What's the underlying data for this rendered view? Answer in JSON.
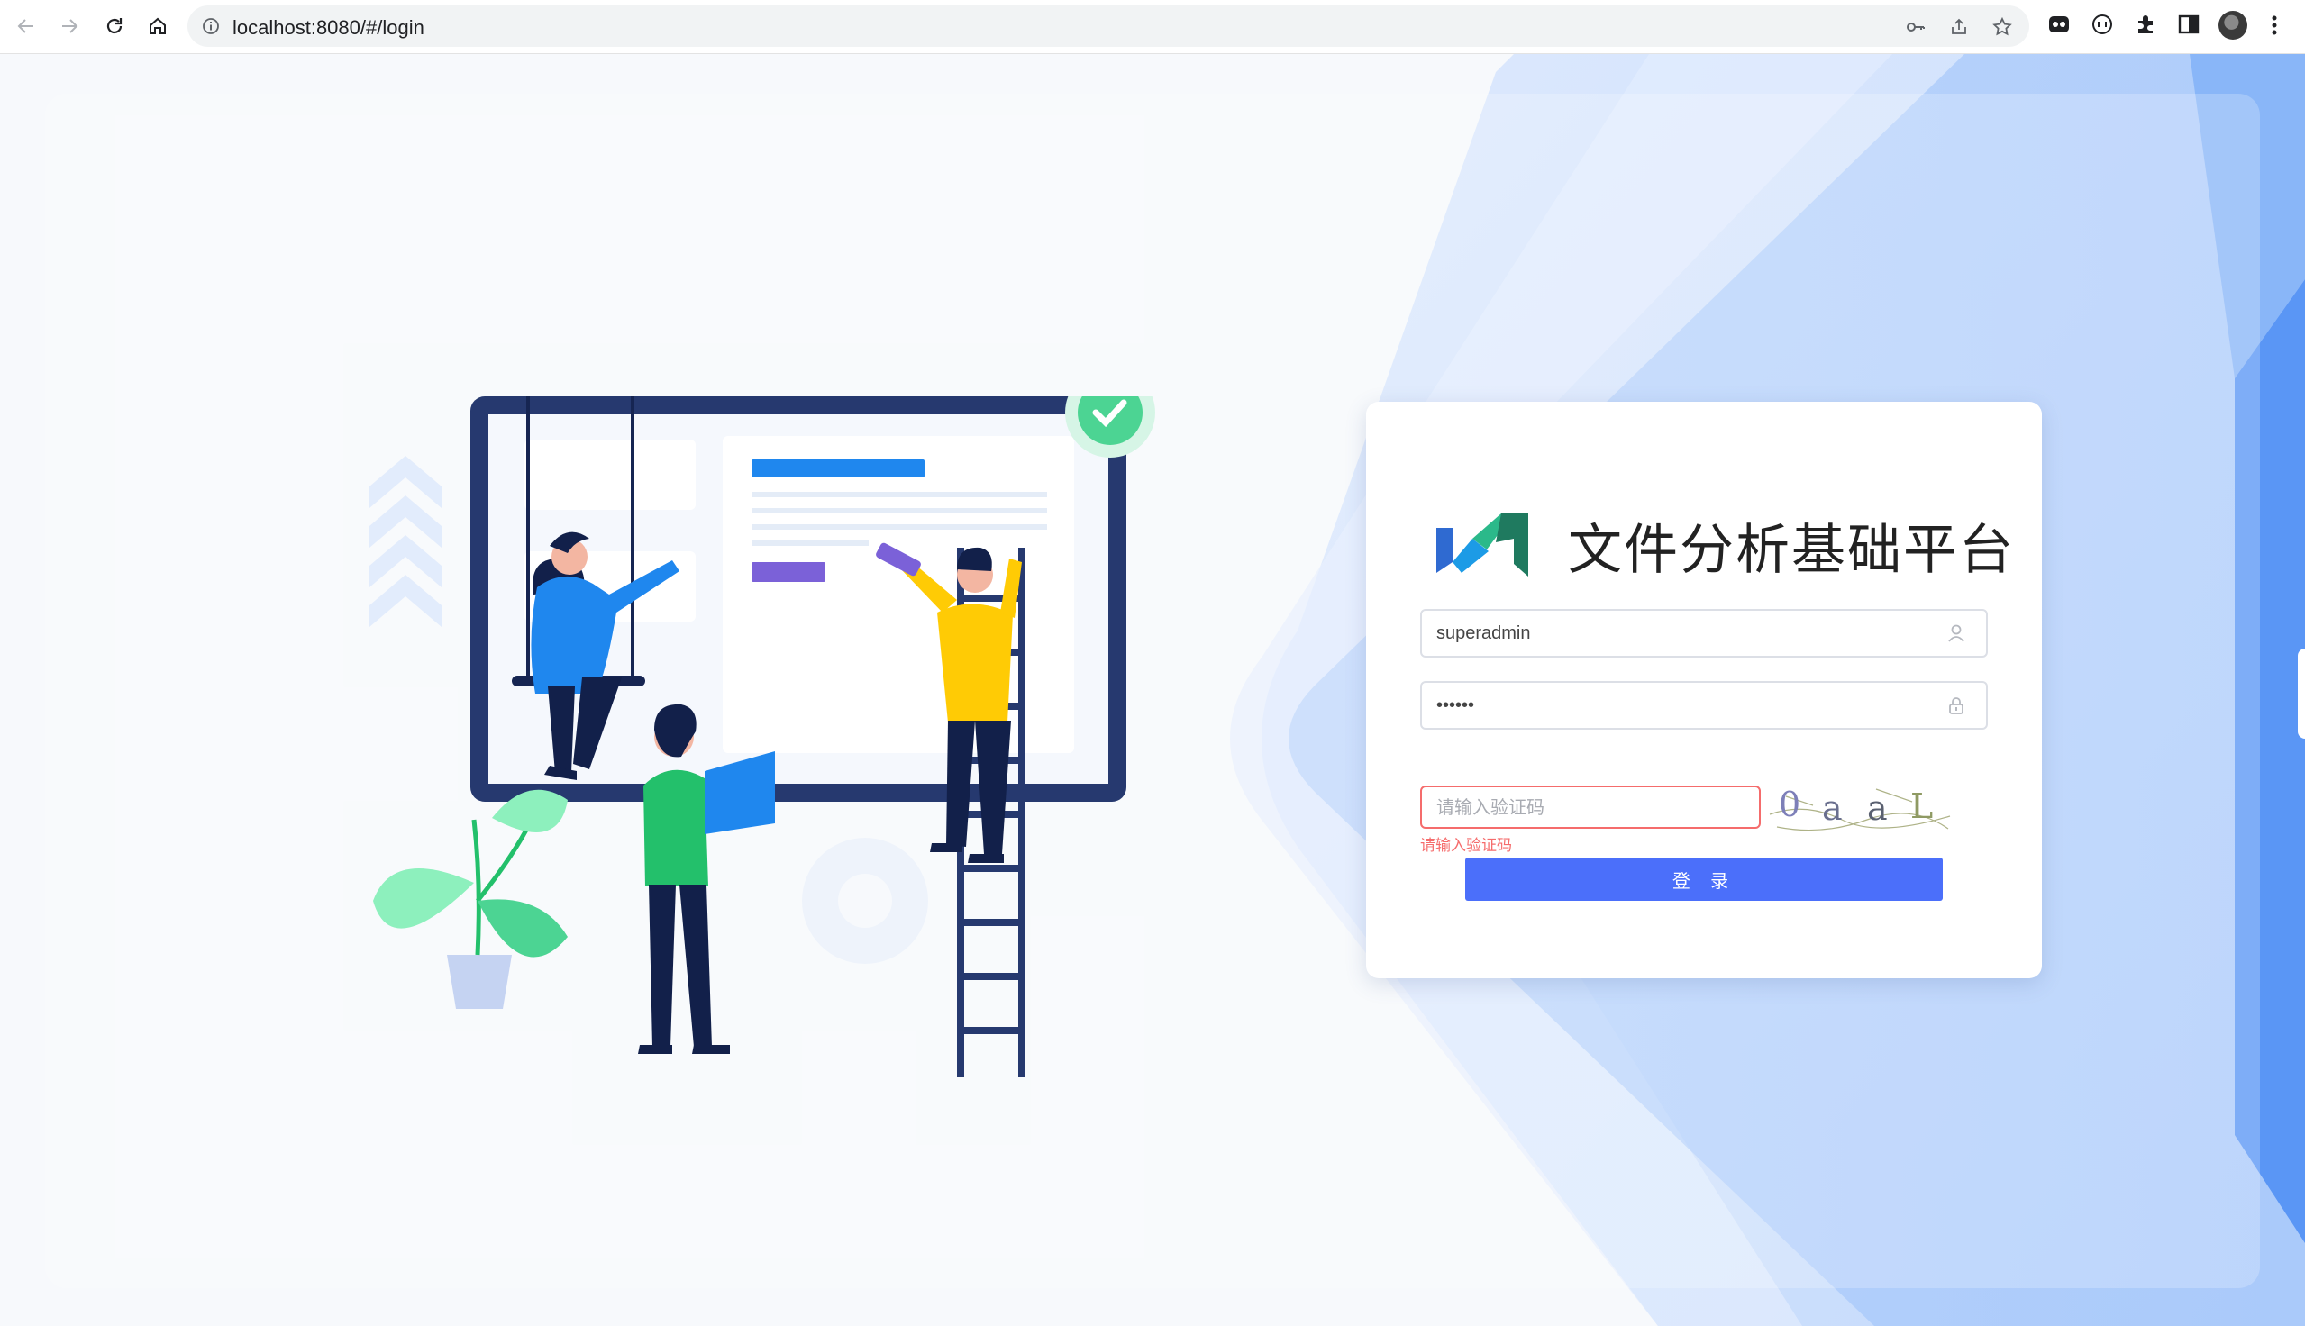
{
  "browser": {
    "url": "localhost:8080/#/login",
    "icons": [
      "back-arrow-icon",
      "forward-arrow-icon",
      "reload-icon",
      "home-icon",
      "info-icon",
      "key-icon",
      "share-icon",
      "star-icon",
      "extension-icon",
      "puzzle-icon",
      "side-panel-icon",
      "profile-avatar",
      "menu-icon"
    ]
  },
  "login": {
    "brand_title": "文件分析基础平台",
    "username_value": "superadmin",
    "password_value": "••••••",
    "captcha_placeholder": "请输入验证码",
    "captcha_error": "请输入验证码",
    "captcha_chars": [
      "0",
      "a",
      "a",
      "L"
    ],
    "submit_label": "登 录"
  },
  "colors": {
    "accent_button": "#4b6ffa",
    "error": "#f56c6c",
    "background_blue": "#a9cbfb",
    "background_deep_blue": "#5a96f5"
  }
}
